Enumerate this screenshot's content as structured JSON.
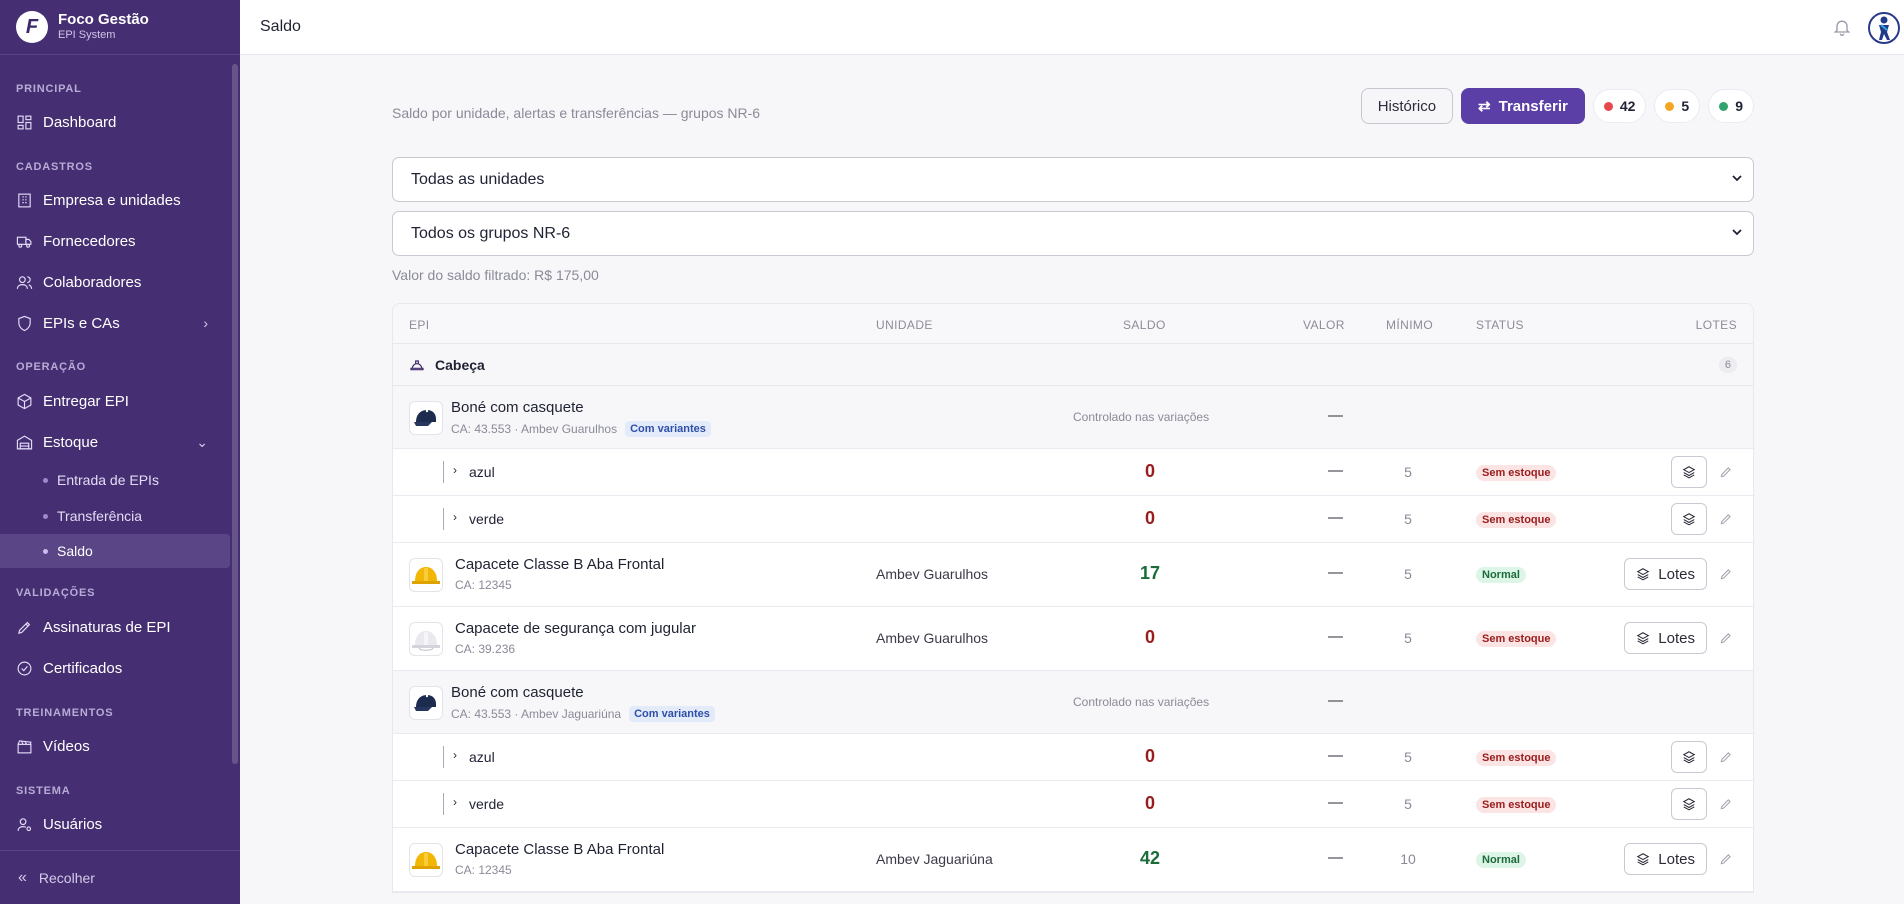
{
  "brand": {
    "logo_letter": "F",
    "name": "Foco Gestão",
    "sub": "EPI System"
  },
  "sidebar": {
    "sections": [
      {
        "title": "PRINCIPAL"
      },
      {
        "title": "CADASTROS"
      },
      {
        "title": "OPERAÇÃO"
      },
      {
        "title": "VALIDAÇÕES"
      },
      {
        "title": "TREINAMENTOS"
      },
      {
        "title": "SISTEMA"
      }
    ],
    "items": {
      "dashboard": "Dashboard",
      "empresa": "Empresa e unidades",
      "fornecedores": "Fornecedores",
      "colaboradores": "Colaboradores",
      "epis": "EPIs e CAs",
      "entregar": "Entregar EPI",
      "estoque": "Estoque",
      "entrada": "Entrada de EPIs",
      "transferencia": "Transferência",
      "saldo": "Saldo",
      "assinaturas": "Assinaturas de EPI",
      "certificados": "Certificados",
      "videos": "Vídeos",
      "usuarios": "Usuários"
    },
    "collapse": "Recolher"
  },
  "topbar": {
    "title": "Saldo"
  },
  "header": {
    "subtitle": "Saldo por unidade, alertas e transferências — grupos NR-6",
    "historico": "Histórico",
    "transferir": "Transferir",
    "counts": {
      "red": "42",
      "amber": "5",
      "green": "9"
    }
  },
  "filters": {
    "unidade": "Todas as unidades",
    "grupo": "Todos os grupos NR-6",
    "valor": "Valor do saldo filtrado: R$ 175,00"
  },
  "table": {
    "columns": {
      "epi": "EPI",
      "unidade": "UNIDADE",
      "saldo": "SALDO",
      "valor": "VALOR",
      "minimo": "MÍNIMO",
      "status": "STATUS",
      "lotes": "LOTES"
    },
    "group": {
      "name": "Cabeça",
      "count": "6"
    },
    "controlled_text": "Controlado nas variações",
    "variants_badge": "Com variantes",
    "dash": "—",
    "lotes_label": "Lotes",
    "rows": [
      {
        "kind": "parent",
        "name": "Boné com casquete",
        "meta": "CA: 43.553 · Ambev Guarulhos",
        "thumb": "cap-icon"
      },
      {
        "kind": "var",
        "name": "azul",
        "saldo": "0",
        "min": "5",
        "status": "Sem estoque"
      },
      {
        "kind": "var",
        "name": "verde",
        "saldo": "0",
        "min": "5",
        "status": "Sem estoque"
      },
      {
        "kind": "prod",
        "name": "Capacete Classe B Aba Frontal",
        "meta": "CA: 12345",
        "unit": "Ambev Guarulhos",
        "saldo": "17",
        "min": "5",
        "status": "Normal",
        "thumb": "helmet-yellow-icon"
      },
      {
        "kind": "prod",
        "name": "Capacete de segurança com jugular",
        "meta": "CA: 39.236",
        "unit": "Ambev Guarulhos",
        "saldo": "0",
        "min": "5",
        "status": "Sem estoque",
        "thumb": "helmet-white-icon"
      },
      {
        "kind": "parent",
        "name": "Boné com casquete",
        "meta": "CA: 43.553 · Ambev Jaguariúna",
        "thumb": "cap-icon"
      },
      {
        "kind": "var",
        "name": "azul",
        "saldo": "0",
        "min": "5",
        "status": "Sem estoque"
      },
      {
        "kind": "var",
        "name": "verde",
        "saldo": "0",
        "min": "5",
        "status": "Sem estoque"
      },
      {
        "kind": "prod",
        "name": "Capacete Classe B Aba Frontal",
        "meta": "CA: 12345",
        "unit": "Ambev Jaguariúna",
        "saldo": "42",
        "min": "10",
        "status": "Normal",
        "thumb": "helmet-yellow-icon"
      }
    ]
  },
  "colors": {
    "sidebar": "#452f72",
    "primary": "#5b3fa6",
    "red": "#e5484d",
    "amber": "#f5a524",
    "green": "#30a46c"
  }
}
